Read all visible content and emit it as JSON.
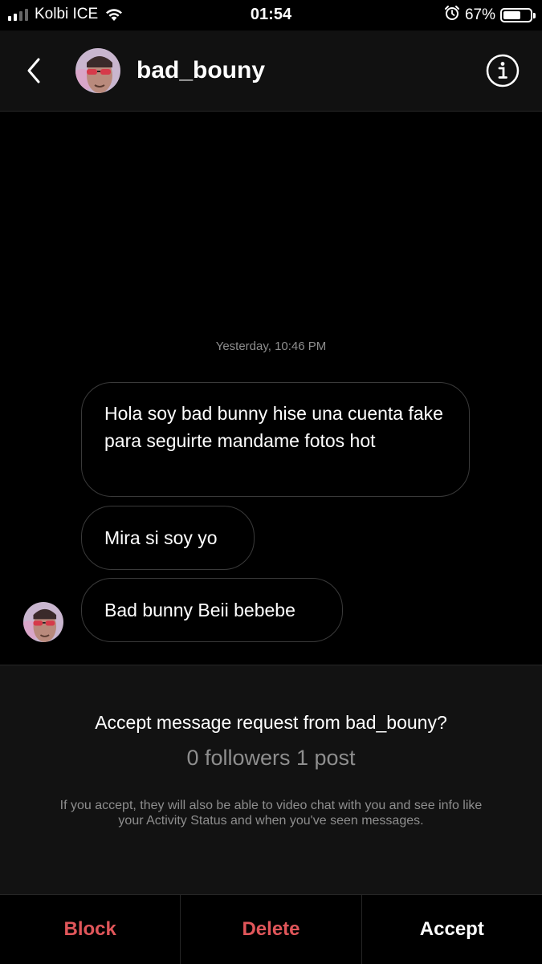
{
  "status_bar": {
    "carrier": "Kolbi ICE",
    "time": "01:54",
    "battery": "67%",
    "battery_level": 0.67,
    "icons": [
      "signal-icon",
      "wifi-icon",
      "alarm-icon",
      "battery-icon"
    ]
  },
  "header": {
    "username": "bad_bouny",
    "icons": [
      "back-chevron-icon",
      "info-icon"
    ]
  },
  "chat": {
    "timestamp": "Yesterday, 10:46 PM",
    "messages": [
      {
        "text": "Hola soy bad bunny hise una cuenta fake para seguirte mandame fotos hot"
      },
      {
        "text": "Mira si soy yo"
      },
      {
        "text": "Bad bunny Beii bebebe"
      }
    ]
  },
  "request": {
    "title": "Accept message request from bad_bouny?",
    "stats": "0 followers 1 post",
    "note": "If you accept, they will also be able to video chat with you and see info like your Activity Status and when you've seen messages."
  },
  "actions": {
    "block": "Block",
    "delete": "Delete",
    "accept": "Accept"
  },
  "colors": {
    "background": "#000000",
    "destructive": "#e0565a",
    "muted_text": "#8e8e8e",
    "bubble_border": "#3a3a3a"
  }
}
